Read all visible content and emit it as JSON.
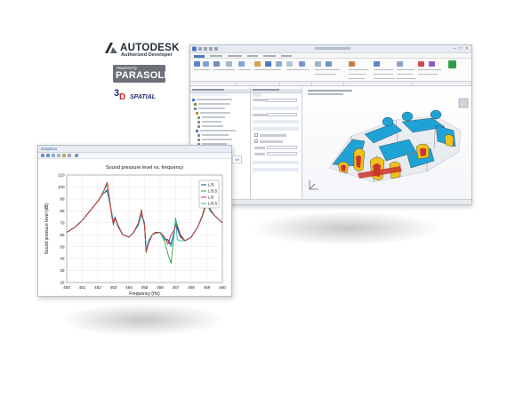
{
  "logos": {
    "autodesk": "AUTODESK",
    "autodesk_sub": "Authorized Developer",
    "parasolid_top": "Powered by",
    "parasolid": "PARASOLID",
    "spatial": "SPATIAL"
  },
  "app_window": {
    "colors": {
      "accent": "#1f77c8",
      "model_blue": "#1fa3d6",
      "model_yellow": "#f0c01c",
      "model_red": "#c9352d"
    }
  },
  "graphics_window": {
    "title": "Graphics",
    "side_tab": "Set"
  },
  "chart_data": {
    "type": "line",
    "title": "Sound pressure level vs. frequency",
    "xlabel": "Frequency (Hz)",
    "ylabel": "Sound pressure level (dB)",
    "xlim": [
      450,
      460
    ],
    "ylim": [
      20,
      110
    ],
    "xticks": [
      "450",
      "451",
      "452",
      "453",
      "454",
      "455",
      "456",
      "457",
      "458",
      "459",
      "460"
    ],
    "yticks": [
      "20",
      "30",
      "40",
      "50",
      "60",
      "70",
      "80",
      "90",
      "100",
      "110"
    ],
    "grid": true,
    "legend_position": "top-right",
    "x": [
      450,
      450.5,
      451,
      451.5,
      452,
      452.3,
      452.6,
      452.8,
      452.9,
      453.0,
      453.1,
      453.3,
      453.6,
      454,
      454.3,
      454.6,
      454.8,
      455.0,
      455.1,
      455.3,
      455.5,
      455.7,
      456,
      456.3,
      456.5,
      456.7,
      456.9,
      457.0,
      457.1,
      457.3,
      457.6,
      458,
      458.4,
      458.7,
      459.0,
      459.2,
      459.5,
      460
    ],
    "series": [
      {
        "name": "L/5",
        "color": "#1f3aa6",
        "values": [
          62,
          66,
          72,
          80,
          88,
          94,
          97,
          84,
          78,
          70,
          75,
          68,
          60,
          58,
          62,
          68,
          77,
          70,
          48,
          56,
          60,
          62,
          62,
          56,
          56,
          52,
          63,
          72,
          68,
          60,
          55,
          58,
          66,
          75,
          88,
          81,
          76,
          70
        ]
      },
      {
        "name": "L/5.5",
        "color": "#2f9e4a",
        "values": [
          62,
          66,
          72,
          80,
          88,
          95,
          102,
          86,
          76,
          68,
          74,
          67,
          60,
          58,
          62,
          69,
          78,
          68,
          45,
          55,
          60,
          61,
          62,
          54,
          44,
          36,
          60,
          74,
          66,
          58,
          55,
          58,
          66,
          76,
          90,
          82,
          76,
          70
        ]
      },
      {
        "name": "L/6",
        "color": "#d12f2f",
        "values": [
          62,
          66,
          72,
          80,
          88,
          94,
          104,
          85,
          75,
          69,
          74,
          67,
          60,
          58,
          62,
          70,
          81,
          67,
          46,
          54,
          60,
          62,
          62,
          58,
          52,
          60,
          64,
          68,
          66,
          59,
          55,
          58,
          66,
          75,
          87,
          81,
          76,
          70
        ]
      },
      {
        "name": "L/6.5",
        "color": "#16b8c8",
        "values": [
          62,
          66,
          72,
          80,
          88,
          94,
          98,
          85,
          77,
          68,
          74,
          67,
          60,
          58,
          62,
          68,
          77,
          69,
          48,
          56,
          60,
          62,
          62,
          56,
          55,
          50,
          62,
          73,
          56,
          55,
          55,
          58,
          66,
          75,
          87,
          80,
          76,
          70
        ]
      },
      {
        "name": "",
        "color": "#333333",
        "values": [
          62,
          66,
          72,
          80,
          88,
          94,
          97,
          85,
          77,
          70,
          74,
          67,
          60,
          58,
          62,
          68,
          77,
          69,
          47,
          56,
          60,
          62,
          62,
          56,
          55,
          52,
          62,
          72,
          65,
          58,
          55,
          58,
          66,
          75,
          88,
          81,
          76,
          70
        ]
      }
    ]
  }
}
